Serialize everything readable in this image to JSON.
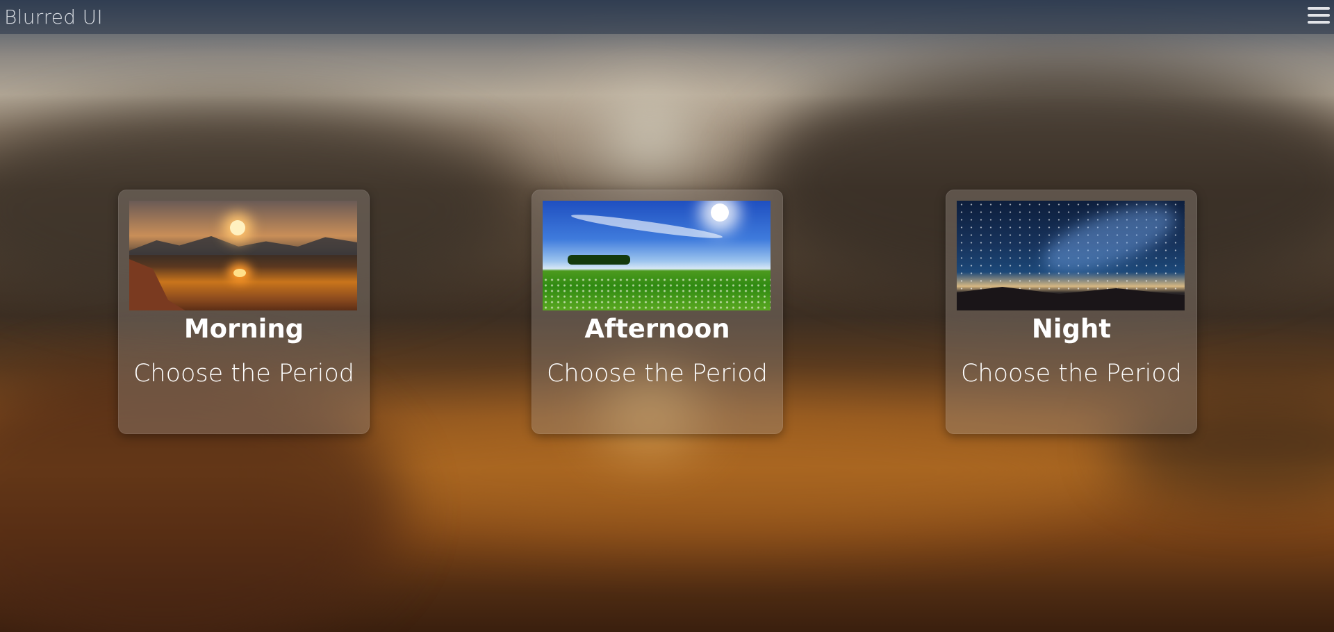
{
  "app": {
    "title": "Blurred UI"
  },
  "header": {
    "menu_icon": "hamburger-menu-icon"
  },
  "cards": [
    {
      "title": "Morning",
      "subtitle": "Choose the Period",
      "image": "sunrise-lake-landscape"
    },
    {
      "title": "Afternoon",
      "subtitle": "Choose the Period",
      "image": "sunny-green-meadow"
    },
    {
      "title": "Night",
      "subtitle": "Choose the Period",
      "image": "starry-night-sky"
    }
  ],
  "colors": {
    "topbar": "#283448",
    "card_text": "#ffffff",
    "brand_text": "#d9dde3"
  }
}
